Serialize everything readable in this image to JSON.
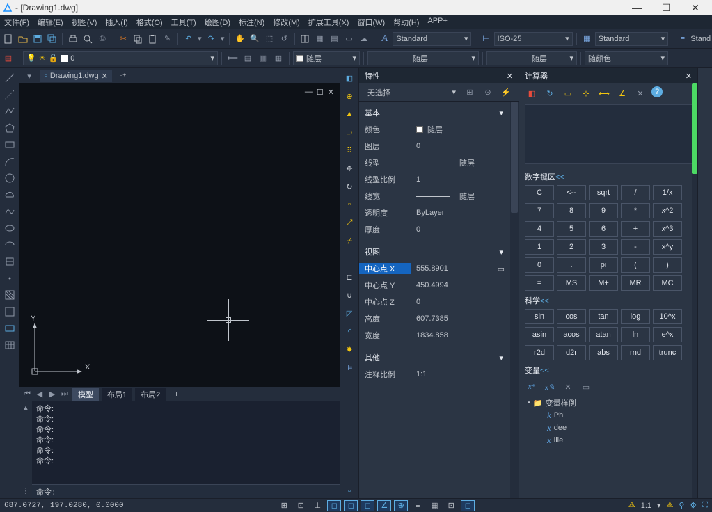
{
  "window": {
    "title": "- [Drawing1.dwg]"
  },
  "menu": [
    "文件(F)",
    "编辑(E)",
    "视图(V)",
    "插入(I)",
    "格式(O)",
    "工具(T)",
    "绘图(D)",
    "标注(N)",
    "修改(M)",
    "扩展工具(X)",
    "窗口(W)",
    "帮助(H)",
    "APP+"
  ],
  "toolbar2": {
    "layer": "0",
    "text_style": "Standard",
    "dim_style": "ISO-25",
    "table_style": "Standard",
    "ml_style": "Stand"
  },
  "layerbar": {
    "color_label": "随层",
    "linetype_label": "随层",
    "lineweight_label": "随层",
    "plot_style": "随颜色"
  },
  "doc_tab": {
    "name": "Drawing1.dwg"
  },
  "ucs": {
    "x": "X",
    "y": "Y"
  },
  "layouts": {
    "model": "模型",
    "layout1": "布局1",
    "layout2": "布局2",
    "plus": "+"
  },
  "cmd": {
    "lines": [
      "命令:",
      "命令:",
      "命令:",
      "命令:",
      "命令:",
      "命令:"
    ],
    "prompt": "命令:"
  },
  "props": {
    "title": "特性",
    "selection": "无选择",
    "sec_basic": "基本",
    "rows_basic": {
      "color_k": "颜色",
      "color_v": "随层",
      "layer_k": "图层",
      "layer_v": "0",
      "ltype_k": "线型",
      "ltype_v": "随层",
      "ltscale_k": "线型比例",
      "ltscale_v": "1",
      "lweight_k": "线宽",
      "lweight_v": "随层",
      "transp_k": "透明度",
      "transp_v": "ByLayer",
      "thick_k": "厚度",
      "thick_v": "0"
    },
    "sec_view": "视图",
    "rows_view": {
      "cx_k": "中心点 X",
      "cx_v": "555.8901",
      "cy_k": "中心点 Y",
      "cy_v": "450.4994",
      "cz_k": "中心点 Z",
      "cz_v": "0",
      "h_k": "高度",
      "h_v": "607.7385",
      "w_k": "宽度",
      "w_v": "1834.858"
    },
    "sec_other": "其他",
    "rows_other": {
      "ann_k": "注释比例",
      "ann_v": "1:1"
    }
  },
  "calc": {
    "title": "计算器",
    "sec_keypad": "数字键区",
    "keys": [
      "C",
      "<--",
      "sqrt",
      "/",
      "1/x",
      "7",
      "8",
      "9",
      "*",
      "x^2",
      "4",
      "5",
      "6",
      "+",
      "x^3",
      "1",
      "2",
      "3",
      "-",
      "x^y",
      "0",
      ".",
      "pi",
      "(",
      ")",
      "=",
      "MS",
      "M+",
      "MR",
      "MC"
    ],
    "sec_sci": "科学",
    "sci_keys": [
      "sin",
      "cos",
      "tan",
      "log",
      "10^x",
      "asin",
      "acos",
      "atan",
      "ln",
      "e^x",
      "r2d",
      "d2r",
      "abs",
      "rnd",
      "trunc"
    ],
    "sec_vars": "变量",
    "var_root": "变量样例",
    "var_children": [
      "Phi",
      "dee",
      "ille"
    ],
    "collapse": "<<"
  },
  "status": {
    "coords": "687.0727, 197.0280, 0.0000",
    "scale": "1:1"
  }
}
